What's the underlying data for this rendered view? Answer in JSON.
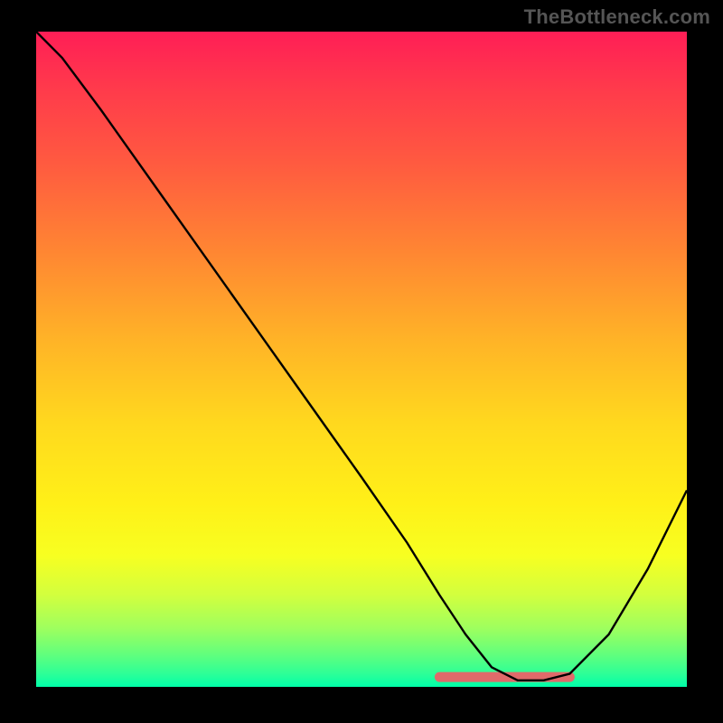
{
  "watermark": "TheBottleneck.com",
  "chart_data": {
    "type": "line",
    "title": "",
    "xlabel": "",
    "ylabel": "",
    "xlim": [
      0,
      100
    ],
    "ylim": [
      0,
      100
    ],
    "grid": false,
    "series": [
      {
        "name": "curve",
        "x": [
          0,
          4,
          10,
          20,
          30,
          40,
          50,
          57,
          62,
          66,
          70,
          74,
          78,
          82,
          88,
          94,
          100
        ],
        "y": [
          100,
          96,
          88,
          74,
          60,
          46,
          32,
          22,
          14,
          8,
          3,
          1,
          1,
          2,
          8,
          18,
          30
        ]
      }
    ],
    "bottom_band": {
      "x_start": 62,
      "x_end": 82,
      "y": 1.5,
      "color": "#e06a6a"
    },
    "colors": {
      "curve": "#000000",
      "band": "#e06a6a",
      "background_top": "#ff1e56",
      "background_bottom": "#00ffa9",
      "frame": "#000000"
    }
  }
}
